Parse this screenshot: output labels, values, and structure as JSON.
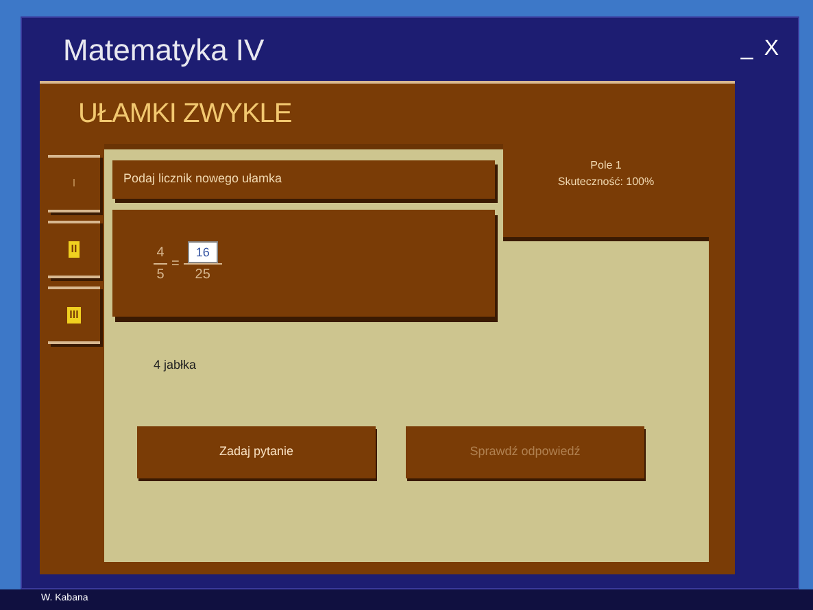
{
  "window": {
    "title": "Matematyka IV",
    "controls": [
      "_",
      "X"
    ]
  },
  "header": "UŁAMKI ZWYKLE",
  "tabs": [
    {
      "label": "I",
      "selected": true
    },
    {
      "label": "II",
      "selected": false
    },
    {
      "label": "III",
      "selected": false
    }
  ],
  "question": "Podaj licznik nowego ułamka",
  "fraction": {
    "left_numerator": "4",
    "left_denominator": "5",
    "equals": "=",
    "answer": "16",
    "right_denominator": "25"
  },
  "info": {
    "field": "Pole 1",
    "score": "Skuteczność: 100%"
  },
  "feedback": "4 jabłka",
  "buttons": [
    {
      "label": "Zadaj pytanie",
      "disabled": false
    },
    {
      "label": "Sprawdź odpowiedź",
      "disabled": true
    }
  ],
  "status_bar": "W. Kabana"
}
